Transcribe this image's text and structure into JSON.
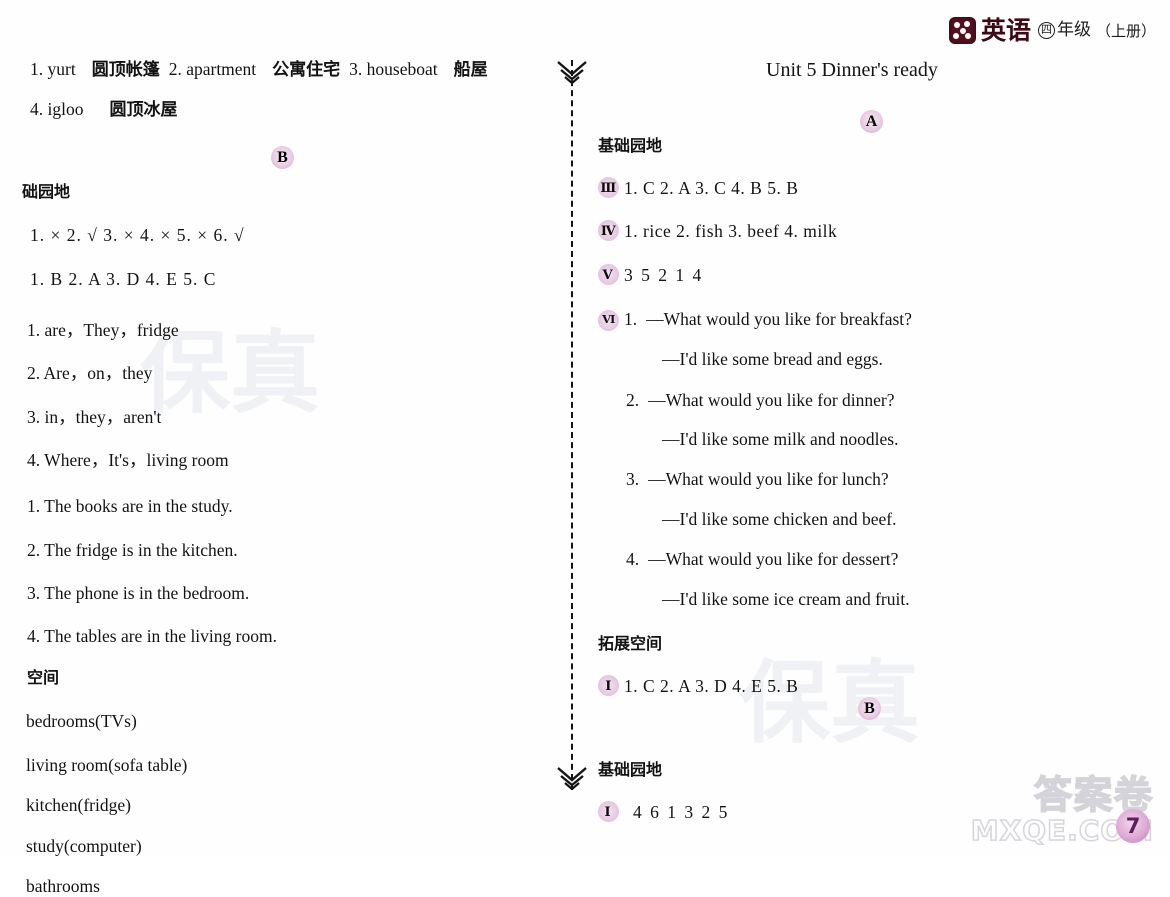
{
  "header": {
    "subject": "英语",
    "grade_circle": "四",
    "grade": "年级",
    "term": "（上册）",
    "dice_icon": "dice-icon"
  },
  "left_column": {
    "vocab_line1": {
      "n1": "1. yurt",
      "t1": "圆顶帐篷",
      "n2": "2. apartment",
      "t2": "公寓住宅",
      "n3": "3. houseboat",
      "t3": "船屋"
    },
    "vocab_line2": {
      "n4": "4. igloo",
      "t4": "圆顶冰屋"
    },
    "section_badge_b": "B",
    "section_heading": "础园地",
    "truefalse_row": "1. ×   2. √   3. ×   4. ×   5. ×   6. √",
    "match_row": "1. B   2. A   3. D   4. E   5. C",
    "fill_blanks": [
      "1. are，They，fridge",
      "2. Are，on，they",
      "3. in，they，aren't",
      "4.  Where，It's，living room"
    ],
    "sentences": [
      "1. The books are in the study.",
      "2. The fridge is in the kitchen.",
      "3. The phone is in the bedroom.",
      "4. The tables are in the living room."
    ],
    "space_heading": "空间",
    "rooms": [
      "bedrooms(TVs)",
      "living room(sofa table)",
      "kitchen(fridge)",
      "study(computer)",
      "bathrooms"
    ]
  },
  "right_column": {
    "unit_title": "Unit 5   Dinner's ready",
    "section_badge_a": "A",
    "section_badge_b": "B",
    "basic_heading_1": "基础园地",
    "ex3": {
      "marker": "Ⅲ",
      "text": "1. C   2. A   3. C   4. B   5. B"
    },
    "ex4": {
      "marker": "Ⅳ",
      "text": "1. rice   2. fish   3. beef   4. milk"
    },
    "ex5": {
      "marker": "Ⅴ",
      "text": "3   5   2   1   4"
    },
    "ex6": {
      "marker": "Ⅵ",
      "items": [
        {
          "num": "1.",
          "q": "—What would you like for breakfast?",
          "a": "—I'd like some bread and eggs."
        },
        {
          "num": "2.",
          "q": "—What would you like for dinner?",
          "a": "—I'd like some milk and noodles."
        },
        {
          "num": "3.",
          "q": "—What would you like for lunch?",
          "a": "—I'd like some chicken and beef."
        },
        {
          "num": "4.",
          "q": "—What would you like for dessert?",
          "a": "—I'd like some ice cream and fruit."
        }
      ]
    },
    "extend_heading": "拓展空间",
    "ex_ext": {
      "marker": "Ⅰ",
      "text": "1. C   2. A   3. D   4. E   5. B"
    },
    "basic_heading_2": "基础园地",
    "ex_basic2": {
      "marker": "Ⅰ",
      "text": "4   6   1   3   2   5"
    }
  },
  "watermark": {
    "cn": "答案卷",
    "url": "MXQE.COM",
    "page_number": "7"
  }
}
